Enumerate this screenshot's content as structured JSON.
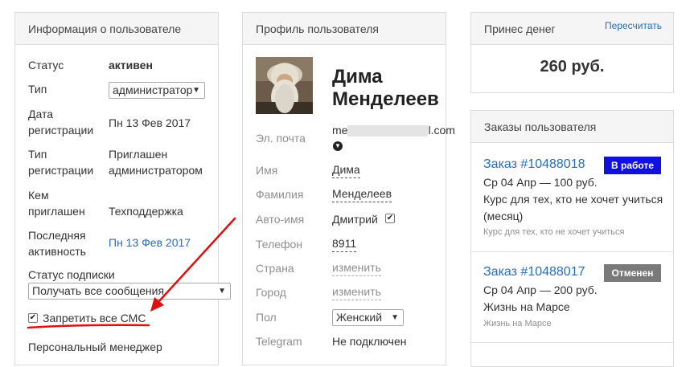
{
  "user_info": {
    "title": "Информация о пользователе",
    "status_label": "Статус",
    "status_value": "активен",
    "type_label": "Тип",
    "type_value": "администратор",
    "regdate_label_1": "Дата",
    "regdate_label_2": "регистрации",
    "regdate_value": "Пн 13 Фев 2017",
    "regtype_label_1": "Тип",
    "regtype_label_2": "регистрации",
    "regtype_value_1": "Приглашен",
    "regtype_value_2": "администратором",
    "invited_label_1": "Кем",
    "invited_label_2": "приглашен",
    "invited_value": "Техподдержка",
    "activity_label_1": "Последняя",
    "activity_label_2": "активность",
    "activity_value": "Пн 13 Фев 2017",
    "subscription_label": "Статус подписки",
    "subscription_value": "Получать все сообщения",
    "sms_label": "Запретить все СМС",
    "sms_checked": true,
    "manager_label": "Персональный менеджер"
  },
  "profile": {
    "title": "Профиль пользователя",
    "name_line1": "Дима",
    "name_line2": "Менделеев",
    "email_label": "Эл. почта",
    "email_start": "me",
    "email_end": "l.com",
    "first_name_label": "Имя",
    "first_name": "Дима",
    "last_name_label": "Фамилия",
    "last_name": "Менделеев",
    "auto_name_label": "Авто-имя",
    "auto_name": "Дмитрий",
    "phone_label": "Телефон",
    "phone": "8911",
    "country_label": "Страна",
    "country_action": "изменить",
    "city_label": "Город",
    "city_action": "изменить",
    "gender_label": "Пол",
    "gender_value": "Женский",
    "telegram_label": "Telegram",
    "telegram_value": "Не подключен"
  },
  "money": {
    "title": "Принес денег",
    "recalc": "Пересчитать",
    "amount": "260 руб."
  },
  "orders": {
    "title": "Заказы пользователя",
    "items": [
      {
        "number": "Заказ #10488018",
        "date_price": "Ср 04 Апр — 100 руб.",
        "course": "Курс для тех, кто не хочет учиться (месяц)",
        "course_line1": "Курс для тех, кто не хочет учиться",
        "course_line2": "(месяц)",
        "sub": "Курс для тех, кто не хочет учиться",
        "badge": "В работе",
        "badge_color": "#1010e0"
      },
      {
        "number": "Заказ #10488017",
        "date_price": "Ср 04 Апр — 200 руб.",
        "course": "Жизнь на Марсе",
        "course_line1": "Жизнь на Марсе",
        "course_line2": "",
        "sub": "Жизнь на Марсе",
        "badge": "Отменен",
        "badge_color": "#7a7a7a"
      }
    ]
  },
  "colors": {
    "link": "#2a6db4",
    "annotation": "#e01010"
  }
}
